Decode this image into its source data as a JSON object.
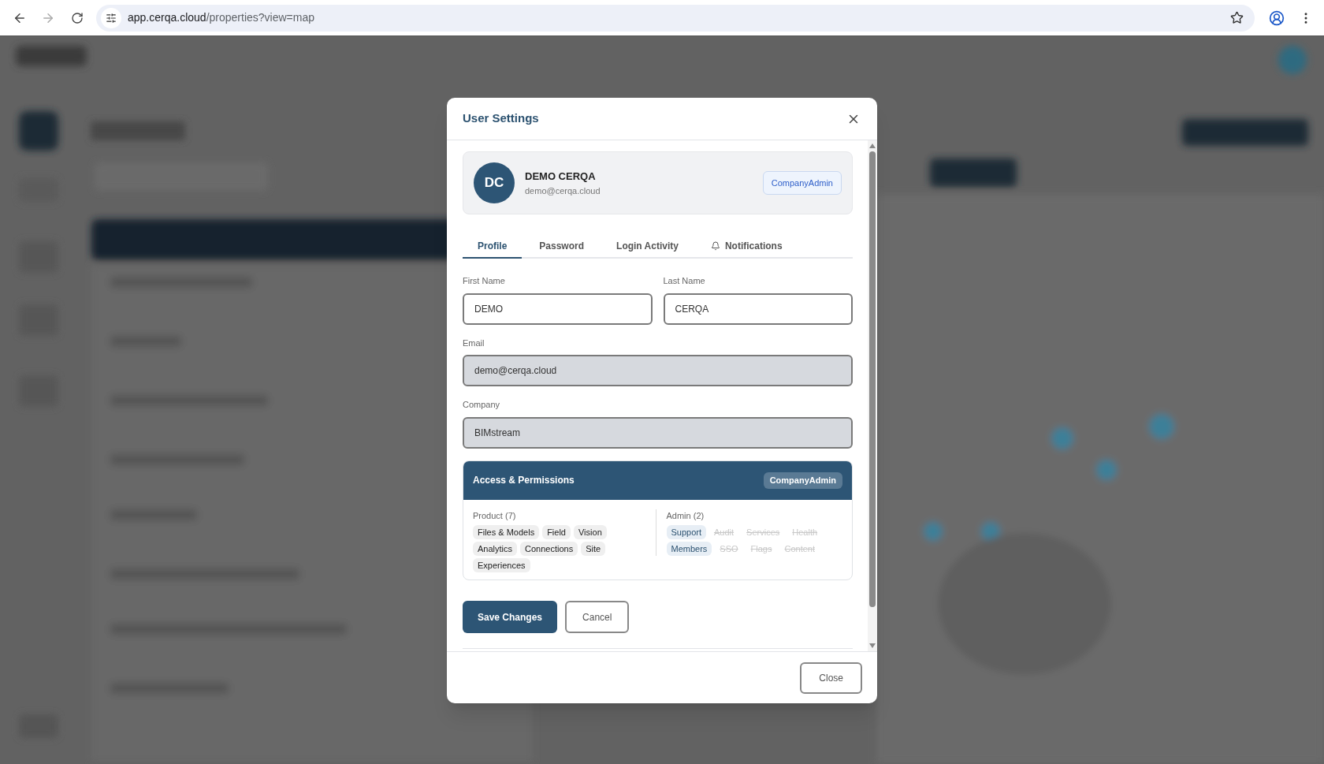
{
  "browser": {
    "url_host": "app.cerqa.cloud",
    "url_path": "/properties?view=map"
  },
  "dialog": {
    "title": "User Settings",
    "user": {
      "initials": "DC",
      "name": "DEMO CERQA",
      "email": "demo@cerqa.cloud",
      "role": "CompanyAdmin"
    },
    "tabs": [
      {
        "label": "Profile",
        "selected": true,
        "kind": "plain"
      },
      {
        "label": "Password",
        "selected": false,
        "kind": "plain"
      },
      {
        "label": "Login Activity",
        "selected": false,
        "kind": "plain"
      },
      {
        "label": "Notifications",
        "selected": false,
        "kind": "alert"
      }
    ],
    "name_fields": [
      {
        "label": "First Name",
        "value": "DEMO",
        "disabled": false
      },
      {
        "label": "Last Name",
        "value": "CERQA",
        "disabled": false
      }
    ],
    "fields": [
      {
        "label": "Email",
        "value": "demo@cerqa.cloud",
        "disabled": true
      },
      {
        "label": "Company",
        "value": "BIMstream",
        "disabled": true
      }
    ],
    "permissions": {
      "title": "Access & Permissions",
      "role": "CompanyAdmin",
      "groups": [
        {
          "title": "Product (7)",
          "items": [
            {
              "label": "Files & Models",
              "enabled": true
            },
            {
              "label": "Field",
              "enabled": true
            },
            {
              "label": "Vision",
              "enabled": true
            },
            {
              "label": "Analytics",
              "enabled": true
            },
            {
              "label": "Connections",
              "enabled": true
            },
            {
              "label": "Site",
              "enabled": true
            },
            {
              "label": "Experiences",
              "enabled": true
            }
          ]
        },
        {
          "title": "Admin (2)",
          "kind": "admin",
          "items": [
            {
              "label": "Support",
              "enabled": true
            },
            {
              "label": "Audit",
              "enabled": false
            },
            {
              "label": "Services",
              "enabled": false
            },
            {
              "label": "Health",
              "enabled": false
            },
            {
              "label": "Members",
              "enabled": true
            },
            {
              "label": "SSO",
              "enabled": false
            },
            {
              "label": "Flags",
              "enabled": false
            },
            {
              "label": "Content",
              "enabled": false
            }
          ]
        }
      ]
    },
    "buttons": [
      {
        "label": "Save Changes",
        "kind": "primary"
      },
      {
        "label": "Cancel",
        "kind": "secondary"
      }
    ],
    "footer_button": "Close"
  }
}
